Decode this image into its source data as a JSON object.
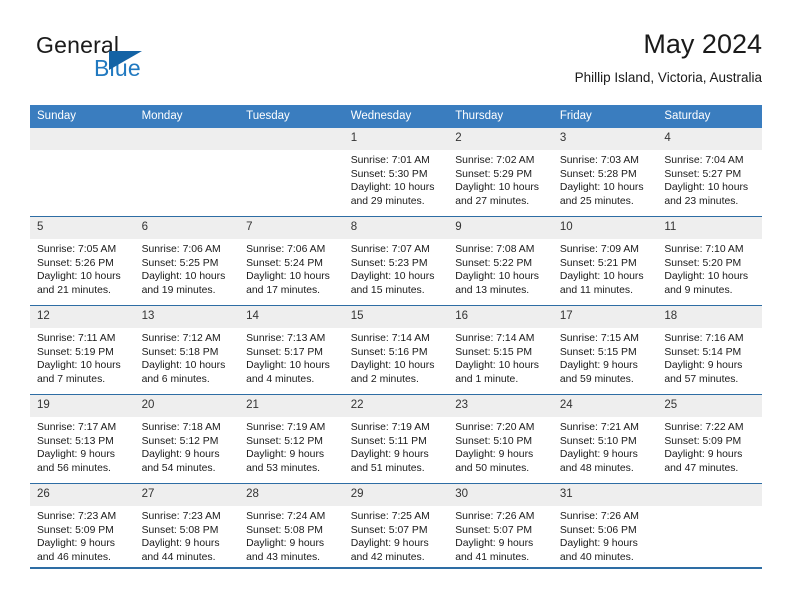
{
  "brand": {
    "name_part1": "General",
    "name_part2": "Blue",
    "mark_icon": "triangle-logo-icon",
    "colors": {
      "general": "#1a1a1a",
      "blue": "#2179c0",
      "mark": "#1463a5"
    }
  },
  "header": {
    "title": "May 2024",
    "subtitle": "Phillip Island, Victoria, Australia"
  },
  "theme": {
    "header_bg": "#3a7dbf",
    "row_divider": "#2e6da4",
    "date_band_bg": "#eeeeee",
    "page_bg": "#ffffff"
  },
  "calendar": {
    "weekday_headers": [
      "Sunday",
      "Monday",
      "Tuesday",
      "Wednesday",
      "Thursday",
      "Friday",
      "Saturday"
    ],
    "weeks": [
      [
        {
          "day": "",
          "empty": true,
          "sunrise": "",
          "sunset": "",
          "daylight_line1": "",
          "daylight_line2": ""
        },
        {
          "day": "",
          "empty": true,
          "sunrise": "",
          "sunset": "",
          "daylight_line1": "",
          "daylight_line2": ""
        },
        {
          "day": "",
          "empty": true,
          "sunrise": "",
          "sunset": "",
          "daylight_line1": "",
          "daylight_line2": ""
        },
        {
          "day": "1",
          "sunrise": "Sunrise: 7:01 AM",
          "sunset": "Sunset: 5:30 PM",
          "daylight_line1": "Daylight: 10 hours",
          "daylight_line2": "and 29 minutes."
        },
        {
          "day": "2",
          "sunrise": "Sunrise: 7:02 AM",
          "sunset": "Sunset: 5:29 PM",
          "daylight_line1": "Daylight: 10 hours",
          "daylight_line2": "and 27 minutes."
        },
        {
          "day": "3",
          "sunrise": "Sunrise: 7:03 AM",
          "sunset": "Sunset: 5:28 PM",
          "daylight_line1": "Daylight: 10 hours",
          "daylight_line2": "and 25 minutes."
        },
        {
          "day": "4",
          "sunrise": "Sunrise: 7:04 AM",
          "sunset": "Sunset: 5:27 PM",
          "daylight_line1": "Daylight: 10 hours",
          "daylight_line2": "and 23 minutes."
        }
      ],
      [
        {
          "day": "5",
          "sunrise": "Sunrise: 7:05 AM",
          "sunset": "Sunset: 5:26 PM",
          "daylight_line1": "Daylight: 10 hours",
          "daylight_line2": "and 21 minutes."
        },
        {
          "day": "6",
          "sunrise": "Sunrise: 7:06 AM",
          "sunset": "Sunset: 5:25 PM",
          "daylight_line1": "Daylight: 10 hours",
          "daylight_line2": "and 19 minutes."
        },
        {
          "day": "7",
          "sunrise": "Sunrise: 7:06 AM",
          "sunset": "Sunset: 5:24 PM",
          "daylight_line1": "Daylight: 10 hours",
          "daylight_line2": "and 17 minutes."
        },
        {
          "day": "8",
          "sunrise": "Sunrise: 7:07 AM",
          "sunset": "Sunset: 5:23 PM",
          "daylight_line1": "Daylight: 10 hours",
          "daylight_line2": "and 15 minutes."
        },
        {
          "day": "9",
          "sunrise": "Sunrise: 7:08 AM",
          "sunset": "Sunset: 5:22 PM",
          "daylight_line1": "Daylight: 10 hours",
          "daylight_line2": "and 13 minutes."
        },
        {
          "day": "10",
          "sunrise": "Sunrise: 7:09 AM",
          "sunset": "Sunset: 5:21 PM",
          "daylight_line1": "Daylight: 10 hours",
          "daylight_line2": "and 11 minutes."
        },
        {
          "day": "11",
          "sunrise": "Sunrise: 7:10 AM",
          "sunset": "Sunset: 5:20 PM",
          "daylight_line1": "Daylight: 10 hours",
          "daylight_line2": "and 9 minutes."
        }
      ],
      [
        {
          "day": "12",
          "sunrise": "Sunrise: 7:11 AM",
          "sunset": "Sunset: 5:19 PM",
          "daylight_line1": "Daylight: 10 hours",
          "daylight_line2": "and 7 minutes."
        },
        {
          "day": "13",
          "sunrise": "Sunrise: 7:12 AM",
          "sunset": "Sunset: 5:18 PM",
          "daylight_line1": "Daylight: 10 hours",
          "daylight_line2": "and 6 minutes."
        },
        {
          "day": "14",
          "sunrise": "Sunrise: 7:13 AM",
          "sunset": "Sunset: 5:17 PM",
          "daylight_line1": "Daylight: 10 hours",
          "daylight_line2": "and 4 minutes."
        },
        {
          "day": "15",
          "sunrise": "Sunrise: 7:14 AM",
          "sunset": "Sunset: 5:16 PM",
          "daylight_line1": "Daylight: 10 hours",
          "daylight_line2": "and 2 minutes."
        },
        {
          "day": "16",
          "sunrise": "Sunrise: 7:14 AM",
          "sunset": "Sunset: 5:15 PM",
          "daylight_line1": "Daylight: 10 hours",
          "daylight_line2": "and 1 minute."
        },
        {
          "day": "17",
          "sunrise": "Sunrise: 7:15 AM",
          "sunset": "Sunset: 5:15 PM",
          "daylight_line1": "Daylight: 9 hours",
          "daylight_line2": "and 59 minutes."
        },
        {
          "day": "18",
          "sunrise": "Sunrise: 7:16 AM",
          "sunset": "Sunset: 5:14 PM",
          "daylight_line1": "Daylight: 9 hours",
          "daylight_line2": "and 57 minutes."
        }
      ],
      [
        {
          "day": "19",
          "sunrise": "Sunrise: 7:17 AM",
          "sunset": "Sunset: 5:13 PM",
          "daylight_line1": "Daylight: 9 hours",
          "daylight_line2": "and 56 minutes."
        },
        {
          "day": "20",
          "sunrise": "Sunrise: 7:18 AM",
          "sunset": "Sunset: 5:12 PM",
          "daylight_line1": "Daylight: 9 hours",
          "daylight_line2": "and 54 minutes."
        },
        {
          "day": "21",
          "sunrise": "Sunrise: 7:19 AM",
          "sunset": "Sunset: 5:12 PM",
          "daylight_line1": "Daylight: 9 hours",
          "daylight_line2": "and 53 minutes."
        },
        {
          "day": "22",
          "sunrise": "Sunrise: 7:19 AM",
          "sunset": "Sunset: 5:11 PM",
          "daylight_line1": "Daylight: 9 hours",
          "daylight_line2": "and 51 minutes."
        },
        {
          "day": "23",
          "sunrise": "Sunrise: 7:20 AM",
          "sunset": "Sunset: 5:10 PM",
          "daylight_line1": "Daylight: 9 hours",
          "daylight_line2": "and 50 minutes."
        },
        {
          "day": "24",
          "sunrise": "Sunrise: 7:21 AM",
          "sunset": "Sunset: 5:10 PM",
          "daylight_line1": "Daylight: 9 hours",
          "daylight_line2": "and 48 minutes."
        },
        {
          "day": "25",
          "sunrise": "Sunrise: 7:22 AM",
          "sunset": "Sunset: 5:09 PM",
          "daylight_line1": "Daylight: 9 hours",
          "daylight_line2": "and 47 minutes."
        }
      ],
      [
        {
          "day": "26",
          "sunrise": "Sunrise: 7:23 AM",
          "sunset": "Sunset: 5:09 PM",
          "daylight_line1": "Daylight: 9 hours",
          "daylight_line2": "and 46 minutes."
        },
        {
          "day": "27",
          "sunrise": "Sunrise: 7:23 AM",
          "sunset": "Sunset: 5:08 PM",
          "daylight_line1": "Daylight: 9 hours",
          "daylight_line2": "and 44 minutes."
        },
        {
          "day": "28",
          "sunrise": "Sunrise: 7:24 AM",
          "sunset": "Sunset: 5:08 PM",
          "daylight_line1": "Daylight: 9 hours",
          "daylight_line2": "and 43 minutes."
        },
        {
          "day": "29",
          "sunrise": "Sunrise: 7:25 AM",
          "sunset": "Sunset: 5:07 PM",
          "daylight_line1": "Daylight: 9 hours",
          "daylight_line2": "and 42 minutes."
        },
        {
          "day": "30",
          "sunrise": "Sunrise: 7:26 AM",
          "sunset": "Sunset: 5:07 PM",
          "daylight_line1": "Daylight: 9 hours",
          "daylight_line2": "and 41 minutes."
        },
        {
          "day": "31",
          "sunrise": "Sunrise: 7:26 AM",
          "sunset": "Sunset: 5:06 PM",
          "daylight_line1": "Daylight: 9 hours",
          "daylight_line2": "and 40 minutes."
        },
        {
          "day": "",
          "empty": true,
          "sunrise": "",
          "sunset": "",
          "daylight_line1": "",
          "daylight_line2": ""
        }
      ]
    ]
  }
}
